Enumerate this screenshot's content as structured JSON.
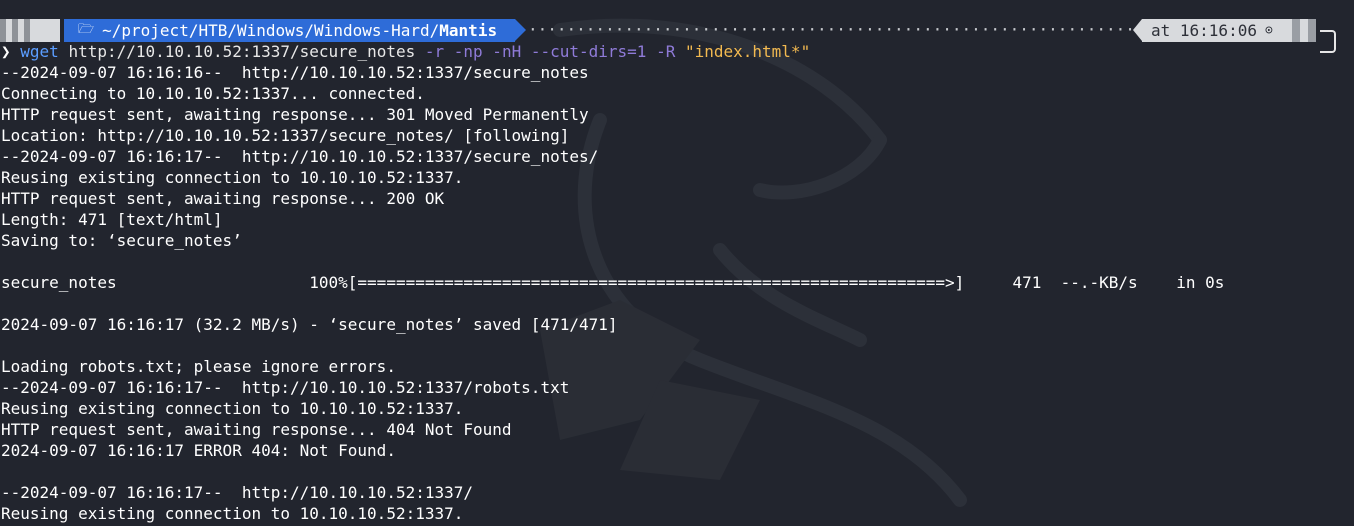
{
  "prompt": {
    "os_glyph": "",
    "path_prefix": "~/project/HTB/Windows/Windows-Hard/",
    "path_current": "Mantis",
    "dots": "··································································································································",
    "time_label": "at 16:16:06",
    "clock_glyph": "⊙"
  },
  "command": {
    "prompt_char": "❯",
    "program": "wget",
    "url": "http://10.10.10.52:1337/secure_notes",
    "flags": "-r -np -nH --cut-dirs=1 -R",
    "pattern": "\"index.html*\""
  },
  "output_lines": [
    "--2024-09-07 16:16:16--  http://10.10.10.52:1337/secure_notes",
    "Connecting to 10.10.10.52:1337... connected.",
    "HTTP request sent, awaiting response... 301 Moved Permanently",
    "Location: http://10.10.10.52:1337/secure_notes/ [following]",
    "--2024-09-07 16:16:17--  http://10.10.10.52:1337/secure_notes/",
    "Reusing existing connection to 10.10.10.52:1337.",
    "HTTP request sent, awaiting response... 200 OK",
    "Length: 471 [text/html]",
    "Saving to: ‘secure_notes’",
    "",
    "secure_notes                    100%[=============================================================>]     471  --.-KB/s    in 0s",
    "",
    "2024-09-07 16:16:17 (32.2 MB/s) - ‘secure_notes’ saved [471/471]",
    "",
    "Loading robots.txt; please ignore errors.",
    "--2024-09-07 16:16:17--  http://10.10.10.52:1337/robots.txt",
    "Reusing existing connection to 10.10.10.52:1337.",
    "HTTP request sent, awaiting response... 404 Not Found",
    "2024-09-07 16:16:17 ERROR 404: Not Found.",
    "",
    "--2024-09-07 16:16:17--  http://10.10.10.52:1337/",
    "Reusing existing connection to 10.10.10.52:1337."
  ],
  "colors": {
    "background": "#22252e",
    "path_segment": "#2e6cd8",
    "command": "#5b9dff",
    "flags": "#8f7bd8",
    "string": "#f2b950"
  }
}
